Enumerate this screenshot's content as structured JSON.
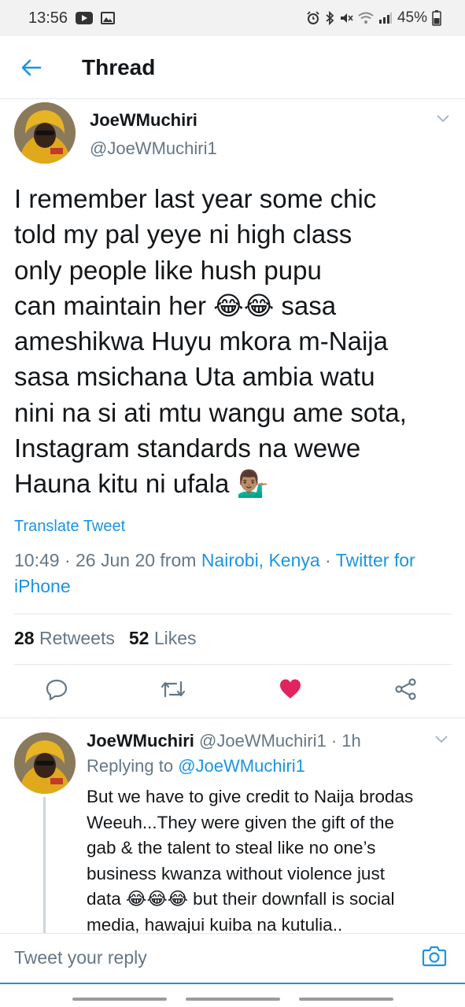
{
  "status_bar": {
    "time": "13:56",
    "battery": "45%",
    "left_icons": [
      "youtube-icon",
      "image-icon"
    ],
    "right_icons": [
      "alarm-icon",
      "bluetooth-icon",
      "mute-icon",
      "wifi-icon",
      "signal-icon",
      "battery-icon"
    ]
  },
  "header": {
    "title": "Thread"
  },
  "main_tweet": {
    "name": "JoeWMuchiri",
    "handle": "@JoeWMuchiri1",
    "text_lines": [
      "I remember last year some chic",
      "told my pal yeye ni high class",
      "only people like hush pupu",
      "can maintain her 😂😂 sasa",
      "ameshikwa Huyu mkora m-Naija",
      "sasa msichana Uta ambia watu",
      "nini na si ati mtu wangu ame sota,",
      "Instagram standards na wewe",
      "Hauna kitu ni ufala 💁🏽‍♂️"
    ],
    "translate_label": "Translate Tweet",
    "timestamp": "10:49 · 26 Jun 20 from ",
    "location": "Nairobi, Kenya",
    "source_sep": " · ",
    "source_part1": "Twitter for",
    "source_part2": "iPhone",
    "retweets_count": "28",
    "retweets_label": "Retweets",
    "likes_count": "52",
    "likes_label": "Likes",
    "like_color": "#e0245e"
  },
  "reply": {
    "name": "JoeWMuchiri",
    "handle": "@JoeWMuchiri1",
    "time": "· 1h",
    "replying_prefix": "Replying to ",
    "replying_to": "@JoeWMuchiri1",
    "text_lines": [
      "But we have to give credit to Naija brodas",
      "Weeuh...They were given the gift of the",
      "gab & the talent to steal like no one’s",
      "business kwanza without violence just",
      "data 😂😂😂 but their downfall is social",
      "media, hawajui kuiba na kutulia.."
    ]
  },
  "composer": {
    "placeholder": "Tweet your reply"
  },
  "colors": {
    "accent": "#1b95e0",
    "text": "#14171a",
    "secondary": "#657786",
    "like": "#e0245e"
  }
}
